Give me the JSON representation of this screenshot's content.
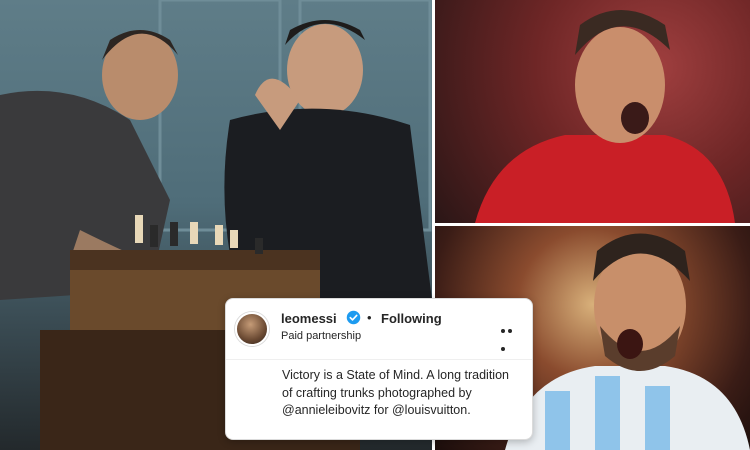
{
  "post": {
    "username": "leomessi",
    "separator": "•",
    "follow_status": "Following",
    "subtitle": "Paid partnership",
    "caption_text": "Victory is a State of Mind. A long tradition of crafting trunks photographed by ",
    "mention_1": "@annieleibovitz",
    "caption_mid": " for ",
    "mention_2": "@louisvuitton",
    "caption_end": "."
  },
  "colors": {
    "verified_badge": "#1d9bf0",
    "text": "#262626",
    "card_border": "#dbdbdb"
  },
  "icons": [
    "verified-icon",
    "more-options-icon"
  ]
}
